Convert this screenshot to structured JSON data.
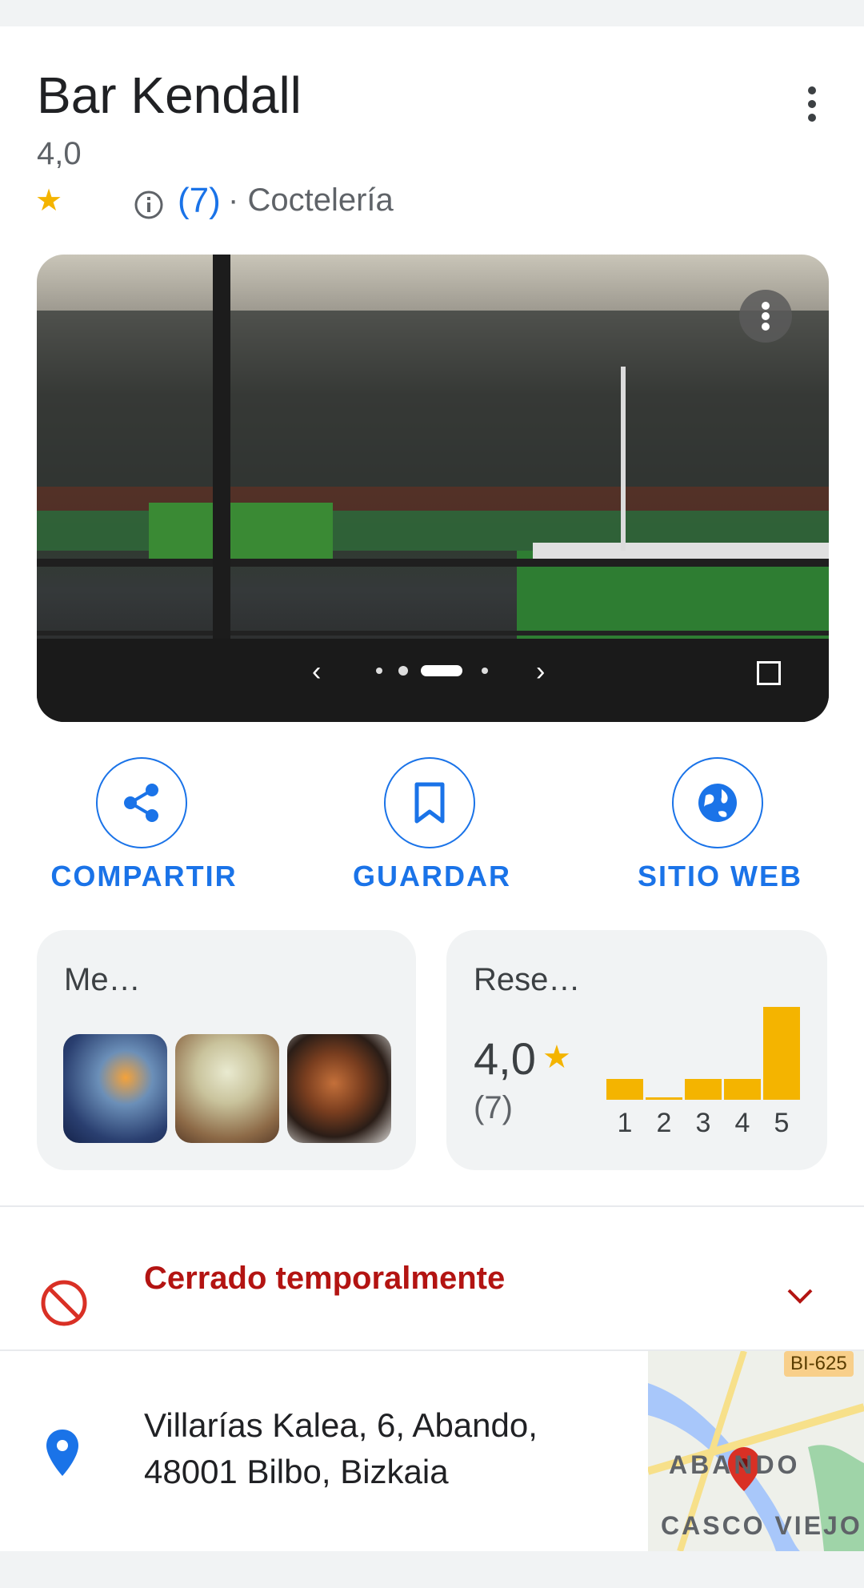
{
  "place": {
    "name": "Bar Kendall",
    "rating": "4,0",
    "review_count_link": "(7)",
    "separator": "·",
    "category": "Coctelería"
  },
  "actions": [
    {
      "label": "COMPARTIR",
      "icon": "share-icon"
    },
    {
      "label": "GUARDAR",
      "icon": "bookmark-icon"
    },
    {
      "label": "SITIO WEB",
      "icon": "globe-icon"
    }
  ],
  "menu_tile": {
    "title": "Me…"
  },
  "reviews_tile": {
    "title": "Rese…",
    "rating": "4,0",
    "count": "(7)",
    "distribution": [
      {
        "stars": "1",
        "share": 0.22
      },
      {
        "stars": "2",
        "share": 0.0
      },
      {
        "stars": "3",
        "share": 0.22
      },
      {
        "stars": "4",
        "share": 0.22
      },
      {
        "stars": "5",
        "share": 1.0
      }
    ]
  },
  "status": {
    "text": "Cerrado temporalmente",
    "color": "#b31412"
  },
  "address": {
    "text": "Villarías Kalea, 6, Abando, 48001 Bilbo, Bizkaia"
  },
  "map": {
    "road_label": "BI-625",
    "area_label": "ABANDO",
    "area_label_2": "CASCO VIEJO"
  },
  "colors": {
    "accent": "#1a73e8",
    "star": "#f4b400",
    "closed": "#b31412"
  }
}
